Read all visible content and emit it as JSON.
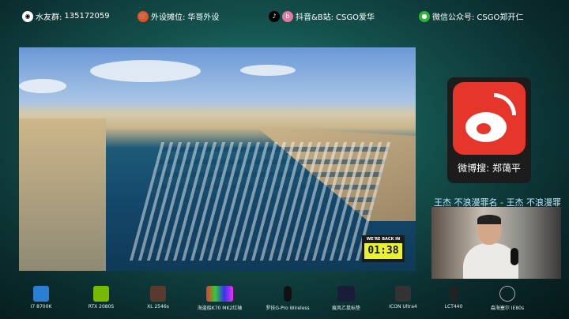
{
  "top_bar": [
    {
      "icon": "qq-icon",
      "label": "水友群:",
      "value": "135172059"
    },
    {
      "icon": "shop-icon",
      "label": "外设摊位:",
      "value": "华哥外设"
    },
    {
      "icon": "douyin-bilibili-icon",
      "label": "抖音&B站:",
      "value": "CSGO爱华"
    },
    {
      "icon": "wechat-icon",
      "label": "微信公众号:",
      "value": "CSGO郑开仁"
    }
  ],
  "timer": {
    "label": "WE'RE BACK IN",
    "value": "01:38"
  },
  "weibo": {
    "label": "微博搜: 郑蔼平"
  },
  "marquee": "王杰 不浪漫罪名 - 王杰 不浪漫罪名",
  "gear": [
    "I7 8700K",
    "RTX 2080S",
    "XL 2546s",
    "海盗船K70 MK2红轴",
    "罗技G-Pro Wireless",
    "痕风乙鼠标垫",
    "ICON Ultra4",
    "LCT440",
    "森海塞尔 IE80s"
  ],
  "colors": {
    "weibo": "#e6352b",
    "timer": "#e9f22a"
  }
}
